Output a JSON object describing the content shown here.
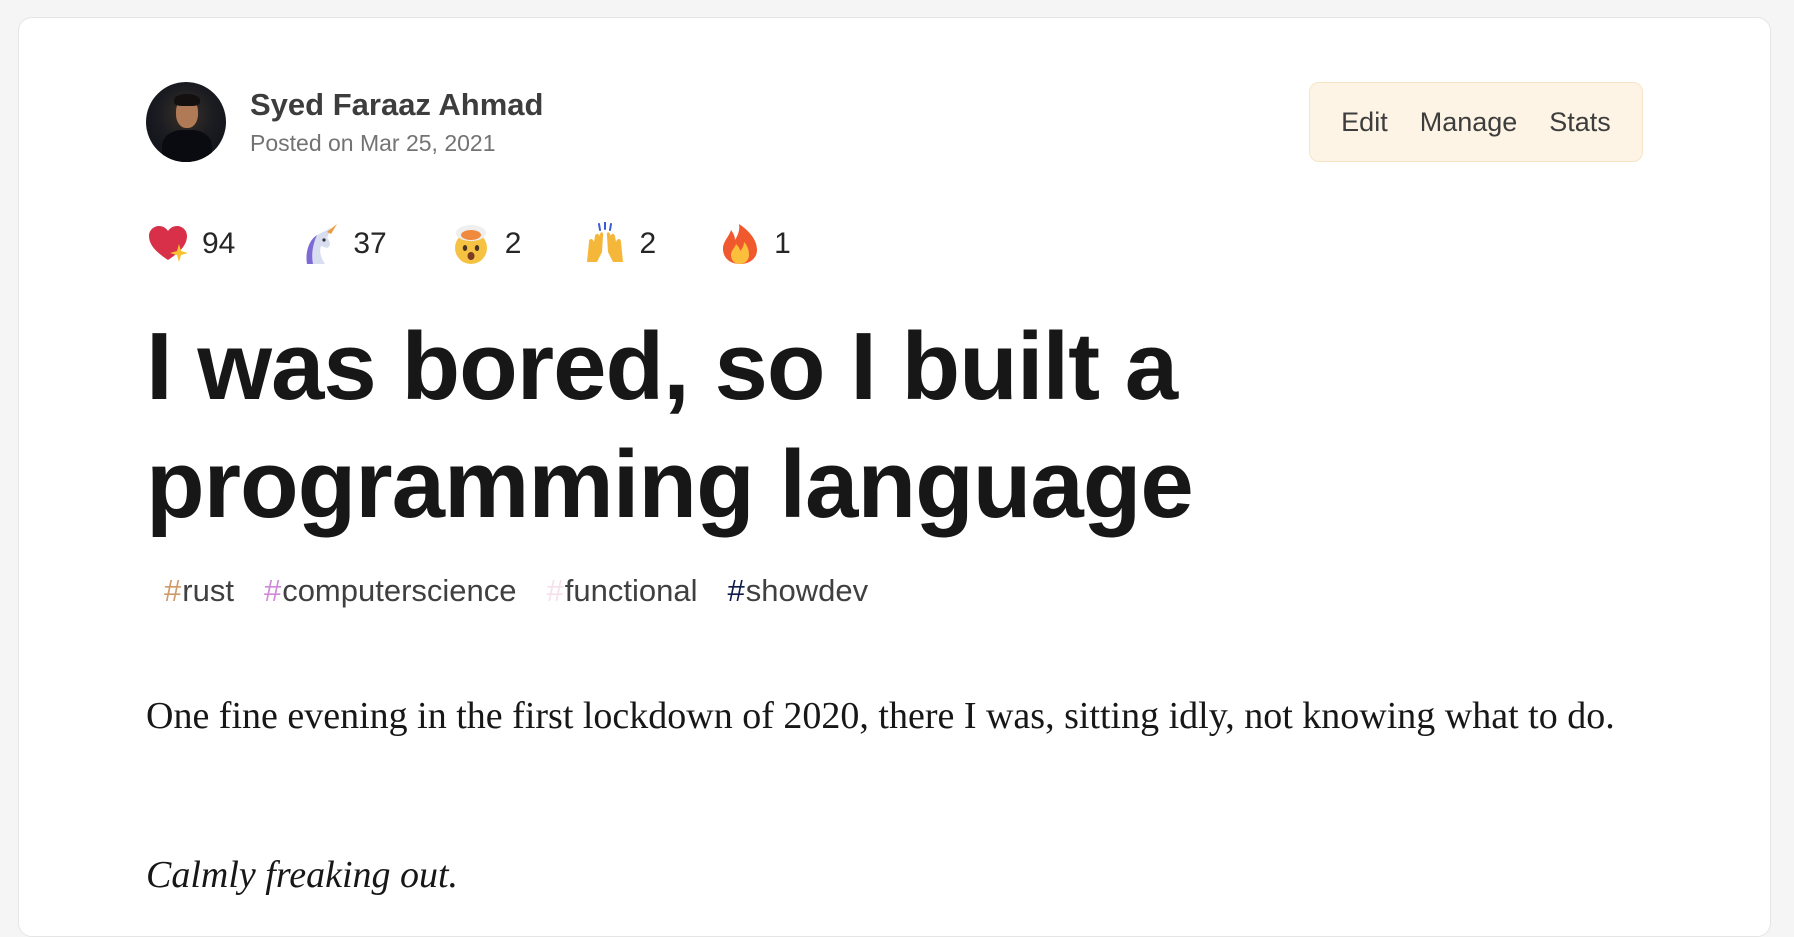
{
  "author": {
    "name": "Syed Faraaz Ahmad",
    "posted": "Posted on Mar 25, 2021"
  },
  "actions": {
    "edit": "Edit",
    "manage": "Manage",
    "stats": "Stats"
  },
  "reactions": [
    {
      "icon": "sparkle-heart-icon",
      "count": "94"
    },
    {
      "icon": "unicorn-icon",
      "count": "37"
    },
    {
      "icon": "exploding-head-icon",
      "count": "2"
    },
    {
      "icon": "raised-hands-icon",
      "count": "2"
    },
    {
      "icon": "fire-icon",
      "count": "1"
    }
  ],
  "title": "I was bored, so I built a programming language",
  "tags": [
    {
      "hash": "#",
      "label": "rust",
      "color": "#d09a6a"
    },
    {
      "hash": "#",
      "label": "computerscience",
      "color": "#d08ad8"
    },
    {
      "hash": "#",
      "label": "functional",
      "color": "#f5e1ec"
    },
    {
      "hash": "#",
      "label": "showdev",
      "color": "#0e1a4a"
    }
  ],
  "body": {
    "p1": "One fine evening in the first lockdown of 2020, there I was, sitting idly, not knowing what to do.",
    "p2": "Calmly freaking out."
  }
}
